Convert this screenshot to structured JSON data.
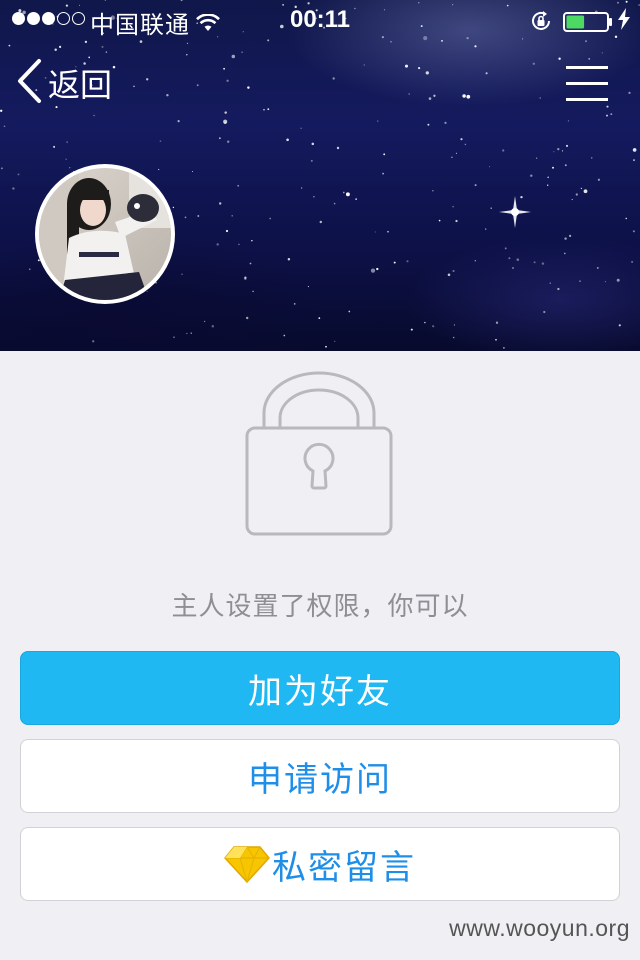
{
  "status_bar": {
    "signal_dots": [
      "full",
      "full",
      "full",
      "empty",
      "empty"
    ],
    "carrier": "中国联通",
    "wifi_icon": "wifi-icon",
    "time": "00:11",
    "rotation_lock_icon": "rotation-lock-icon",
    "battery_icon": "battery-icon",
    "battery_level": 0.45,
    "battery_color": "#4cd964",
    "charging_icon": "charging-bolt-icon"
  },
  "nav": {
    "back_icon": "chevron-left-icon",
    "back_label": "返回",
    "menu_icon": "hamburger-menu-icon"
  },
  "profile": {
    "avatar_icon": "avatar-photo"
  },
  "locked": {
    "lock_icon": "padlock-icon",
    "message": "主人设置了权限，你可以",
    "add_friend_label": "加为好友",
    "request_access_label": "申请访问",
    "private_message_icon": "yellow-diamond-icon",
    "private_message_label": "私密留言"
  },
  "watermark": "www.wooyun.org",
  "colors": {
    "primary_button": "#20b8f2",
    "link_text": "#1e8ee8",
    "background": "#efeff4",
    "muted_text": "#8e8e93"
  }
}
